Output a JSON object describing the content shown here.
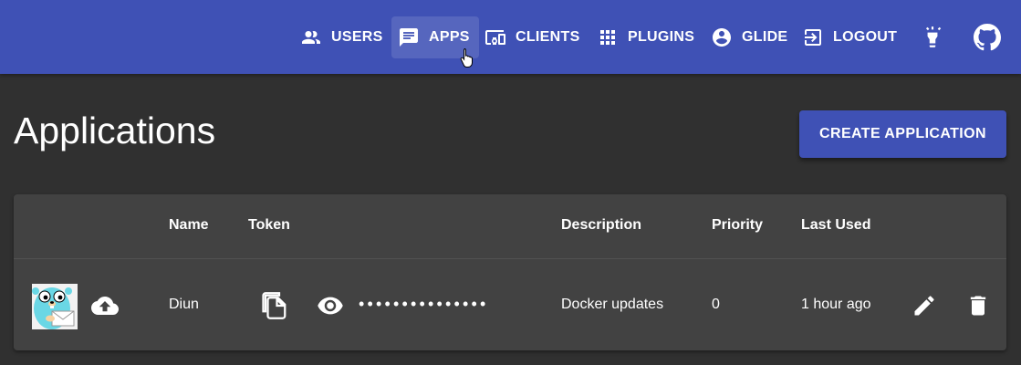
{
  "nav": {
    "users": "USERS",
    "apps": "APPS",
    "clients": "CLIENTS",
    "plugins": "PLUGINS",
    "glide": "GLIDE",
    "logout": "LOGOUT",
    "active": "apps"
  },
  "icons": {
    "theme_toggle": "lightbulb-icon",
    "github": "github-icon"
  },
  "page": {
    "title": "Applications",
    "create_button": "CREATE APPLICATION"
  },
  "table": {
    "columns": [
      "",
      "Name",
      "Token",
      "Description",
      "Priority",
      "Last Used",
      "",
      ""
    ],
    "rows": [
      {
        "image": "gopher-app-icon",
        "upload_icon": "cloud-upload-icon",
        "name": "Diun",
        "copy_icon": "copy-icon",
        "visibility_icon": "eye-icon",
        "token": "•••••••••••••••",
        "description": "Docker updates",
        "priority": "0",
        "last_used": "1 hour ago",
        "edit_icon": "pencil-icon",
        "delete_icon": "trash-icon"
      }
    ]
  },
  "colors": {
    "primary": "#3f51b5",
    "background": "#303030",
    "surface": "#424242"
  }
}
